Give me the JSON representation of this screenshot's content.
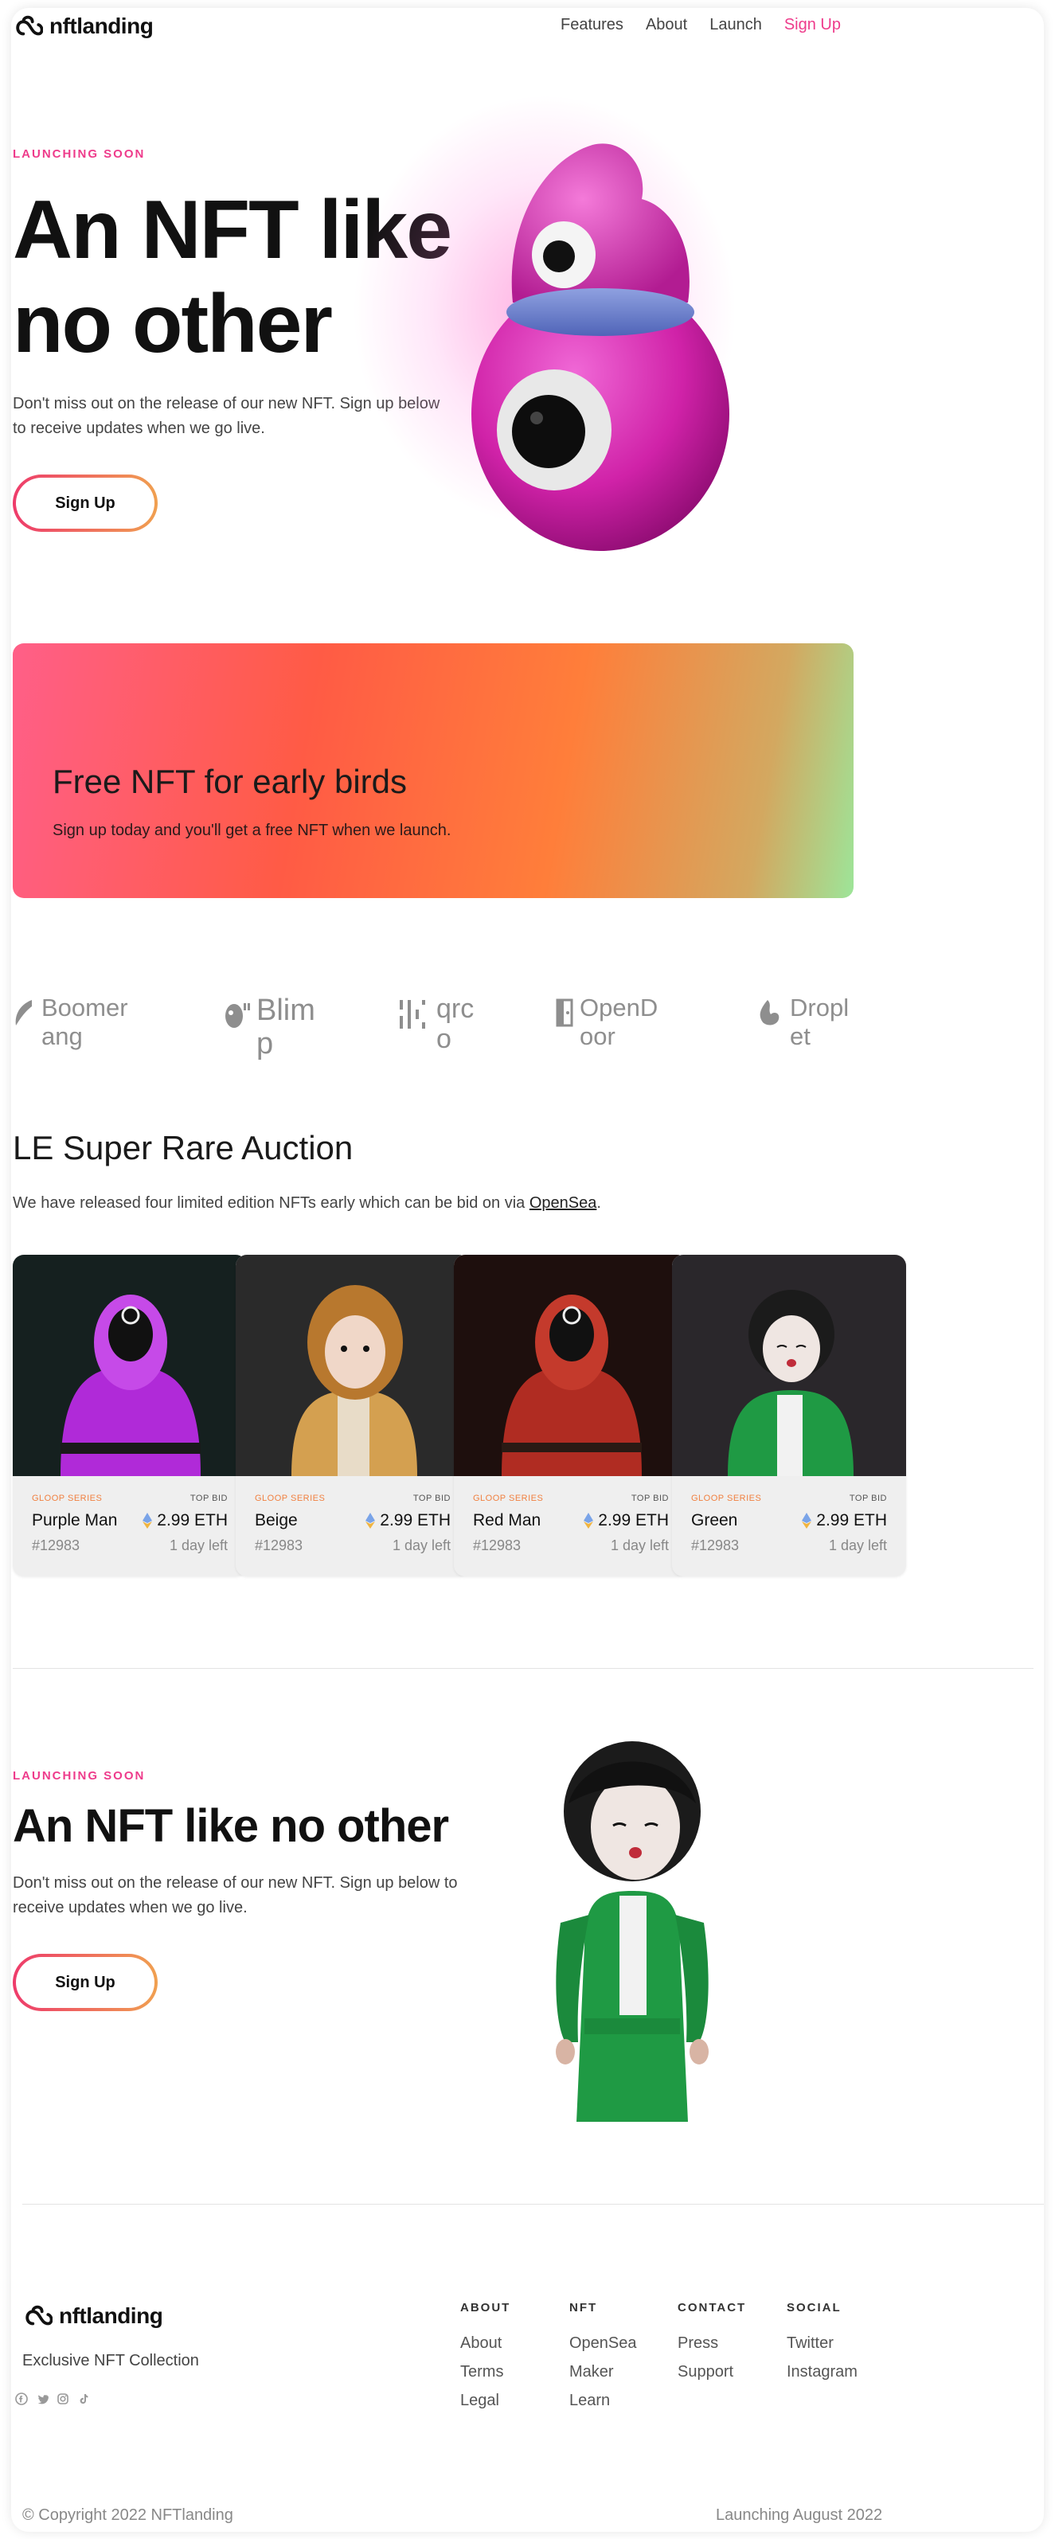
{
  "nav": {
    "logo_text": "nftlanding",
    "links": [
      "Features",
      "About",
      "Launch",
      "Sign Up"
    ]
  },
  "hero": {
    "eyebrow": "LAUNCHING SOON",
    "title": "An NFT like no other",
    "text": "Don't miss out on the release of our new NFT. Sign up below to receive updates when we go live.",
    "button": "Sign Up"
  },
  "promo": {
    "title": "Free NFT for early birds",
    "text": "Sign up today and you'll get a free NFT when we launch."
  },
  "partners": [
    "Boomerang",
    "Blimp",
    "qrco",
    "OpenDoor",
    "Droplet"
  ],
  "auction": {
    "title": "LE Super Rare Auction",
    "text_before": "We have released four limited edition NFTs early which can be bid on via ",
    "link": "OpenSea",
    "text_after": ".",
    "cards": [
      {
        "series": "GLOOP SERIES",
        "bid_label": "TOP BID",
        "name": "Purple Man",
        "price": "2.99 ETH",
        "id": "#12983",
        "time_left": "1 day left"
      },
      {
        "series": "GLOOP SERIES",
        "bid_label": "TOP BID",
        "name": "Beige",
        "price": "2.99 ETH",
        "id": "#12983",
        "time_left": "1 day left"
      },
      {
        "series": "GLOOP SERIES",
        "bid_label": "TOP BID",
        "name": "Red Man",
        "price": "2.99 ETH",
        "id": "#12983",
        "time_left": "1 day left"
      },
      {
        "series": "GLOOP SERIES",
        "bid_label": "TOP BID",
        "name": "Green",
        "price": "2.99 ETH",
        "id": "#12983",
        "time_left": "1 day left"
      }
    ]
  },
  "hero2": {
    "eyebrow": "LAUNCHING SOON",
    "title": "An NFT like no other",
    "text": "Don't miss out on the release of our new NFT. Sign up below to receive updates when we go live.",
    "button": "Sign Up"
  },
  "footer": {
    "logo_text": "nftlanding",
    "tagline": "Exclusive NFT Collection",
    "socials": [
      "facebook-icon",
      "twitter-icon",
      "instagram-icon",
      "tiktok-icon"
    ],
    "columns": [
      {
        "heading": "ABOUT",
        "links": [
          "About",
          "Terms",
          "Legal"
        ]
      },
      {
        "heading": "NFT",
        "links": [
          "OpenSea",
          "Maker",
          "Learn"
        ]
      },
      {
        "heading": "CONTACT",
        "links": [
          "Press",
          "Support"
        ]
      },
      {
        "heading": "SOCIAL",
        "links": [
          "Twitter",
          "Instagram"
        ]
      }
    ],
    "copyright": "© Copyright 2022 NFTlanding",
    "launch_note": "Launching August 2022"
  },
  "colors": {
    "accent": "#ee3b8b",
    "series_label": "#f08040",
    "button_gradient_start": "#ee3b6b",
    "button_gradient_end": "#f0a050"
  }
}
